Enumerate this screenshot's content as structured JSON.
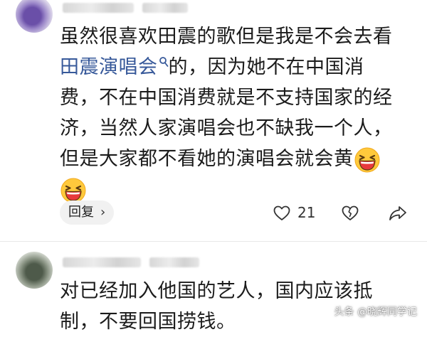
{
  "comments": [
    {
      "lines": [
        "虽然很喜欢田震的歌但是我是不会去看",
        "的，因为她不在中国消",
        "费，不在中国消费就是不支持国家的经",
        "济，当然人家演唱会也不缺我一个人，",
        "但是大家都不看她的演唱会就会黄"
      ],
      "link_text": "田震演唱会",
      "emoji": "grinning-squinting-face-emoji",
      "reply_label": "回复",
      "like_count": "21"
    },
    {
      "lines": [
        "对已经加入他国的艺人，国内应该抵",
        "制，不要回国捞钱。"
      ]
    }
  ],
  "watermark": "头条 @晓辉同学记",
  "colors": {
    "link": "#37599a",
    "text": "#1b1b1b",
    "emoji_face": "#ffc93c",
    "emoji_mouth": "#e8393c"
  }
}
